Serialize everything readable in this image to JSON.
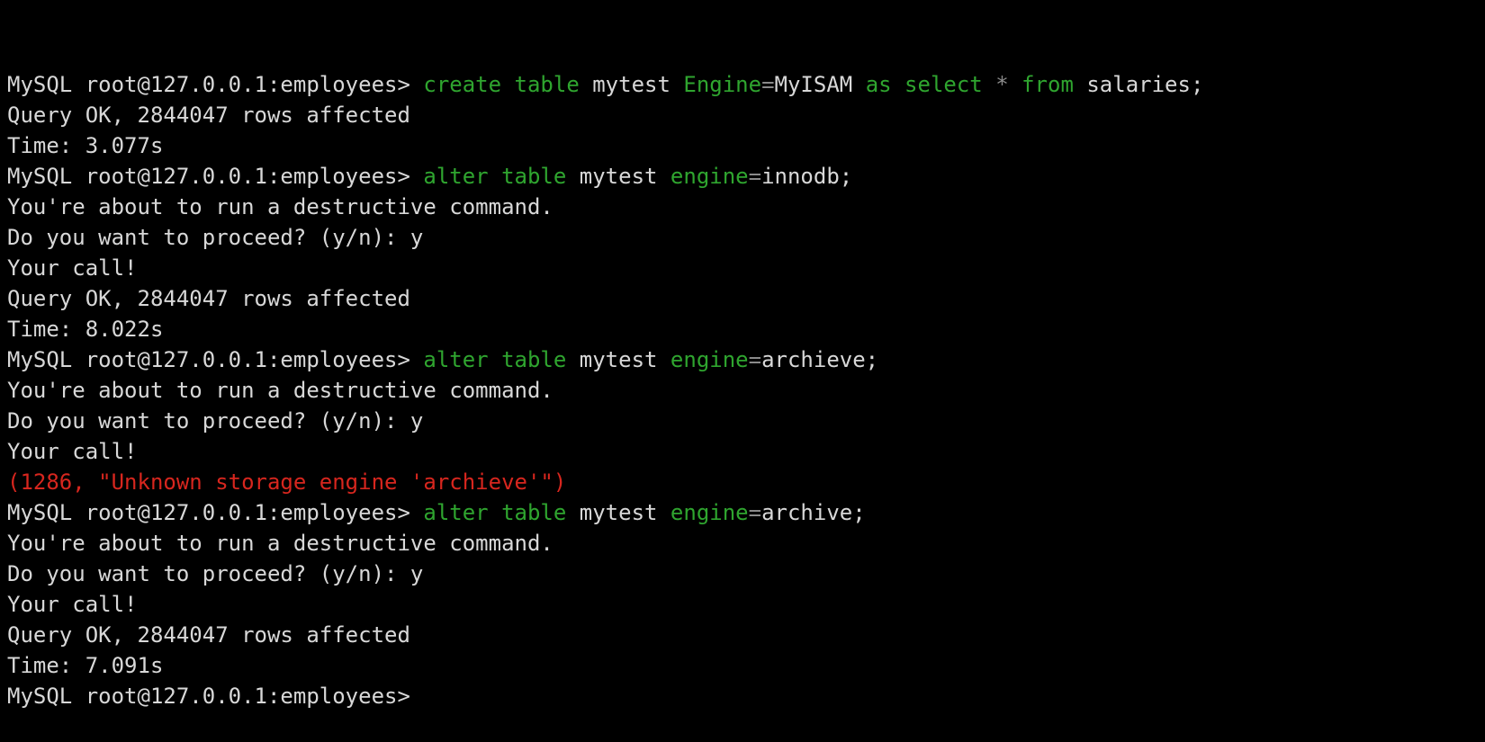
{
  "colors": {
    "background": "#000000",
    "text": "#d8d8d8",
    "keyword": "#2fa52f",
    "operator": "#8a8a8a",
    "error": "#d7261e"
  },
  "lines": [
    {
      "type": "prompt",
      "segments": [
        {
          "t": "MySQL root@127.0.0.1:employees> ",
          "c": "plain"
        },
        {
          "t": "create",
          "c": "kw"
        },
        {
          "t": " ",
          "c": "plain"
        },
        {
          "t": "table",
          "c": "kw"
        },
        {
          "t": " mytest ",
          "c": "plain"
        },
        {
          "t": "Engine",
          "c": "kw"
        },
        {
          "t": "=",
          "c": "op"
        },
        {
          "t": "MyISAM ",
          "c": "plain"
        },
        {
          "t": "as",
          "c": "kw"
        },
        {
          "t": " ",
          "c": "plain"
        },
        {
          "t": "select",
          "c": "kw"
        },
        {
          "t": " ",
          "c": "plain"
        },
        {
          "t": "*",
          "c": "op"
        },
        {
          "t": " ",
          "c": "plain"
        },
        {
          "t": "from",
          "c": "kw"
        },
        {
          "t": " salaries;",
          "c": "plain"
        }
      ]
    },
    {
      "type": "output",
      "segments": [
        {
          "t": "Query OK, 2844047 rows affected",
          "c": "plain"
        }
      ]
    },
    {
      "type": "output",
      "segments": [
        {
          "t": "Time: 3.077s",
          "c": "plain"
        }
      ]
    },
    {
      "type": "prompt",
      "segments": [
        {
          "t": "MySQL root@127.0.0.1:employees> ",
          "c": "plain"
        },
        {
          "t": "alter",
          "c": "kw"
        },
        {
          "t": " ",
          "c": "plain"
        },
        {
          "t": "table",
          "c": "kw"
        },
        {
          "t": " mytest ",
          "c": "plain"
        },
        {
          "t": "engine",
          "c": "kw"
        },
        {
          "t": "=",
          "c": "op"
        },
        {
          "t": "innodb;",
          "c": "plain"
        }
      ]
    },
    {
      "type": "output",
      "segments": [
        {
          "t": "You're about to run a destructive command.",
          "c": "plain"
        }
      ]
    },
    {
      "type": "output",
      "segments": [
        {
          "t": "Do you want to proceed? (y/n): y",
          "c": "plain"
        }
      ]
    },
    {
      "type": "output",
      "segments": [
        {
          "t": "Your call!",
          "c": "plain"
        }
      ]
    },
    {
      "type": "output",
      "segments": [
        {
          "t": "Query OK, 2844047 rows affected",
          "c": "plain"
        }
      ]
    },
    {
      "type": "output",
      "segments": [
        {
          "t": "Time: 8.022s",
          "c": "plain"
        }
      ]
    },
    {
      "type": "prompt",
      "segments": [
        {
          "t": "MySQL root@127.0.0.1:employees> ",
          "c": "plain"
        },
        {
          "t": "alter",
          "c": "kw"
        },
        {
          "t": " ",
          "c": "plain"
        },
        {
          "t": "table",
          "c": "kw"
        },
        {
          "t": " mytest ",
          "c": "plain"
        },
        {
          "t": "engine",
          "c": "kw"
        },
        {
          "t": "=",
          "c": "op"
        },
        {
          "t": "archieve;",
          "c": "plain"
        }
      ]
    },
    {
      "type": "output",
      "segments": [
        {
          "t": "You're about to run a destructive command.",
          "c": "plain"
        }
      ]
    },
    {
      "type": "output",
      "segments": [
        {
          "t": "Do you want to proceed? (y/n): y",
          "c": "plain"
        }
      ]
    },
    {
      "type": "output",
      "segments": [
        {
          "t": "Your call!",
          "c": "plain"
        }
      ]
    },
    {
      "type": "error",
      "segments": [
        {
          "t": "(1286, \"Unknown storage engine 'archieve'\")",
          "c": "err"
        }
      ]
    },
    {
      "type": "prompt",
      "segments": [
        {
          "t": "MySQL root@127.0.0.1:employees> ",
          "c": "plain"
        },
        {
          "t": "alter",
          "c": "kw"
        },
        {
          "t": " ",
          "c": "plain"
        },
        {
          "t": "table",
          "c": "kw"
        },
        {
          "t": " mytest ",
          "c": "plain"
        },
        {
          "t": "engine",
          "c": "kw"
        },
        {
          "t": "=",
          "c": "op"
        },
        {
          "t": "archive;",
          "c": "plain"
        }
      ]
    },
    {
      "type": "output",
      "segments": [
        {
          "t": "You're about to run a destructive command.",
          "c": "plain"
        }
      ]
    },
    {
      "type": "output",
      "segments": [
        {
          "t": "Do you want to proceed? (y/n): y",
          "c": "plain"
        }
      ]
    },
    {
      "type": "output",
      "segments": [
        {
          "t": "Your call!",
          "c": "plain"
        }
      ]
    },
    {
      "type": "output",
      "segments": [
        {
          "t": "Query OK, 2844047 rows affected",
          "c": "plain"
        }
      ]
    },
    {
      "type": "output",
      "segments": [
        {
          "t": "Time: 7.091s",
          "c": "plain"
        }
      ]
    },
    {
      "type": "prompt-active",
      "segments": [
        {
          "t": "MySQL root@127.0.0.1:employees> ",
          "c": "plain"
        }
      ]
    }
  ]
}
